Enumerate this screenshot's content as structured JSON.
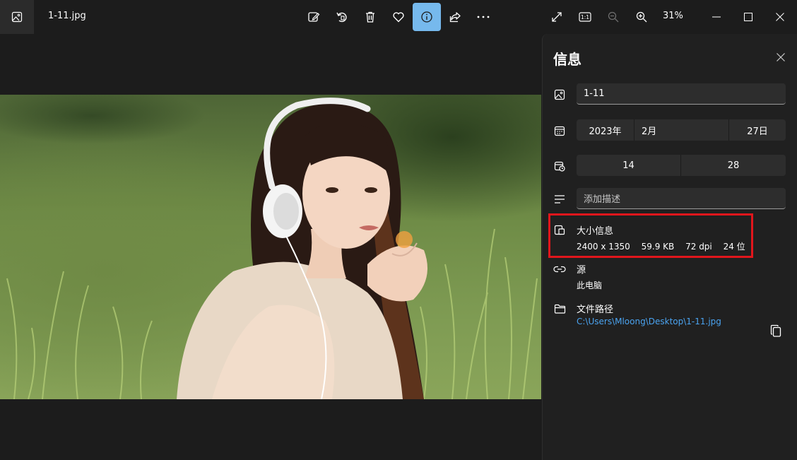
{
  "titlebar": {
    "file_name": "1-11.jpg",
    "zoom": "31%",
    "toolbar_icons": [
      "edit-icon",
      "rotate-icon",
      "delete-icon",
      "favorite-icon",
      "info-icon",
      "share-icon",
      "more-icon"
    ],
    "view_icons": [
      "fullscreen-icon",
      "actual-size-icon",
      "zoom-out-icon",
      "zoom-in-icon"
    ],
    "window_icons": [
      "minimize-icon",
      "maximize-icon",
      "close-icon"
    ],
    "actual_size_label": "1:1"
  },
  "panel": {
    "title": "信息",
    "name_value": "1-11",
    "date": {
      "year": "2023年",
      "month": "2月",
      "day": "27日"
    },
    "time": {
      "hour": "14",
      "minute": "28"
    },
    "description_placeholder": "添加描述",
    "size_info": {
      "heading": "大小信息",
      "dimensions": "2400 x 1350",
      "file_size": "59.9 KB",
      "dpi": "72 dpi",
      "bit_depth": "24 位"
    },
    "source": {
      "heading": "源",
      "value": "此电脑"
    },
    "file_path": {
      "heading": "文件路径",
      "value": "C:\\Users\\Mloong\\Desktop\\1-11.jpg"
    }
  },
  "colors": {
    "accent": "#76b9ed",
    "highlight_box": "#e1161c",
    "link": "#4aa3f0"
  }
}
